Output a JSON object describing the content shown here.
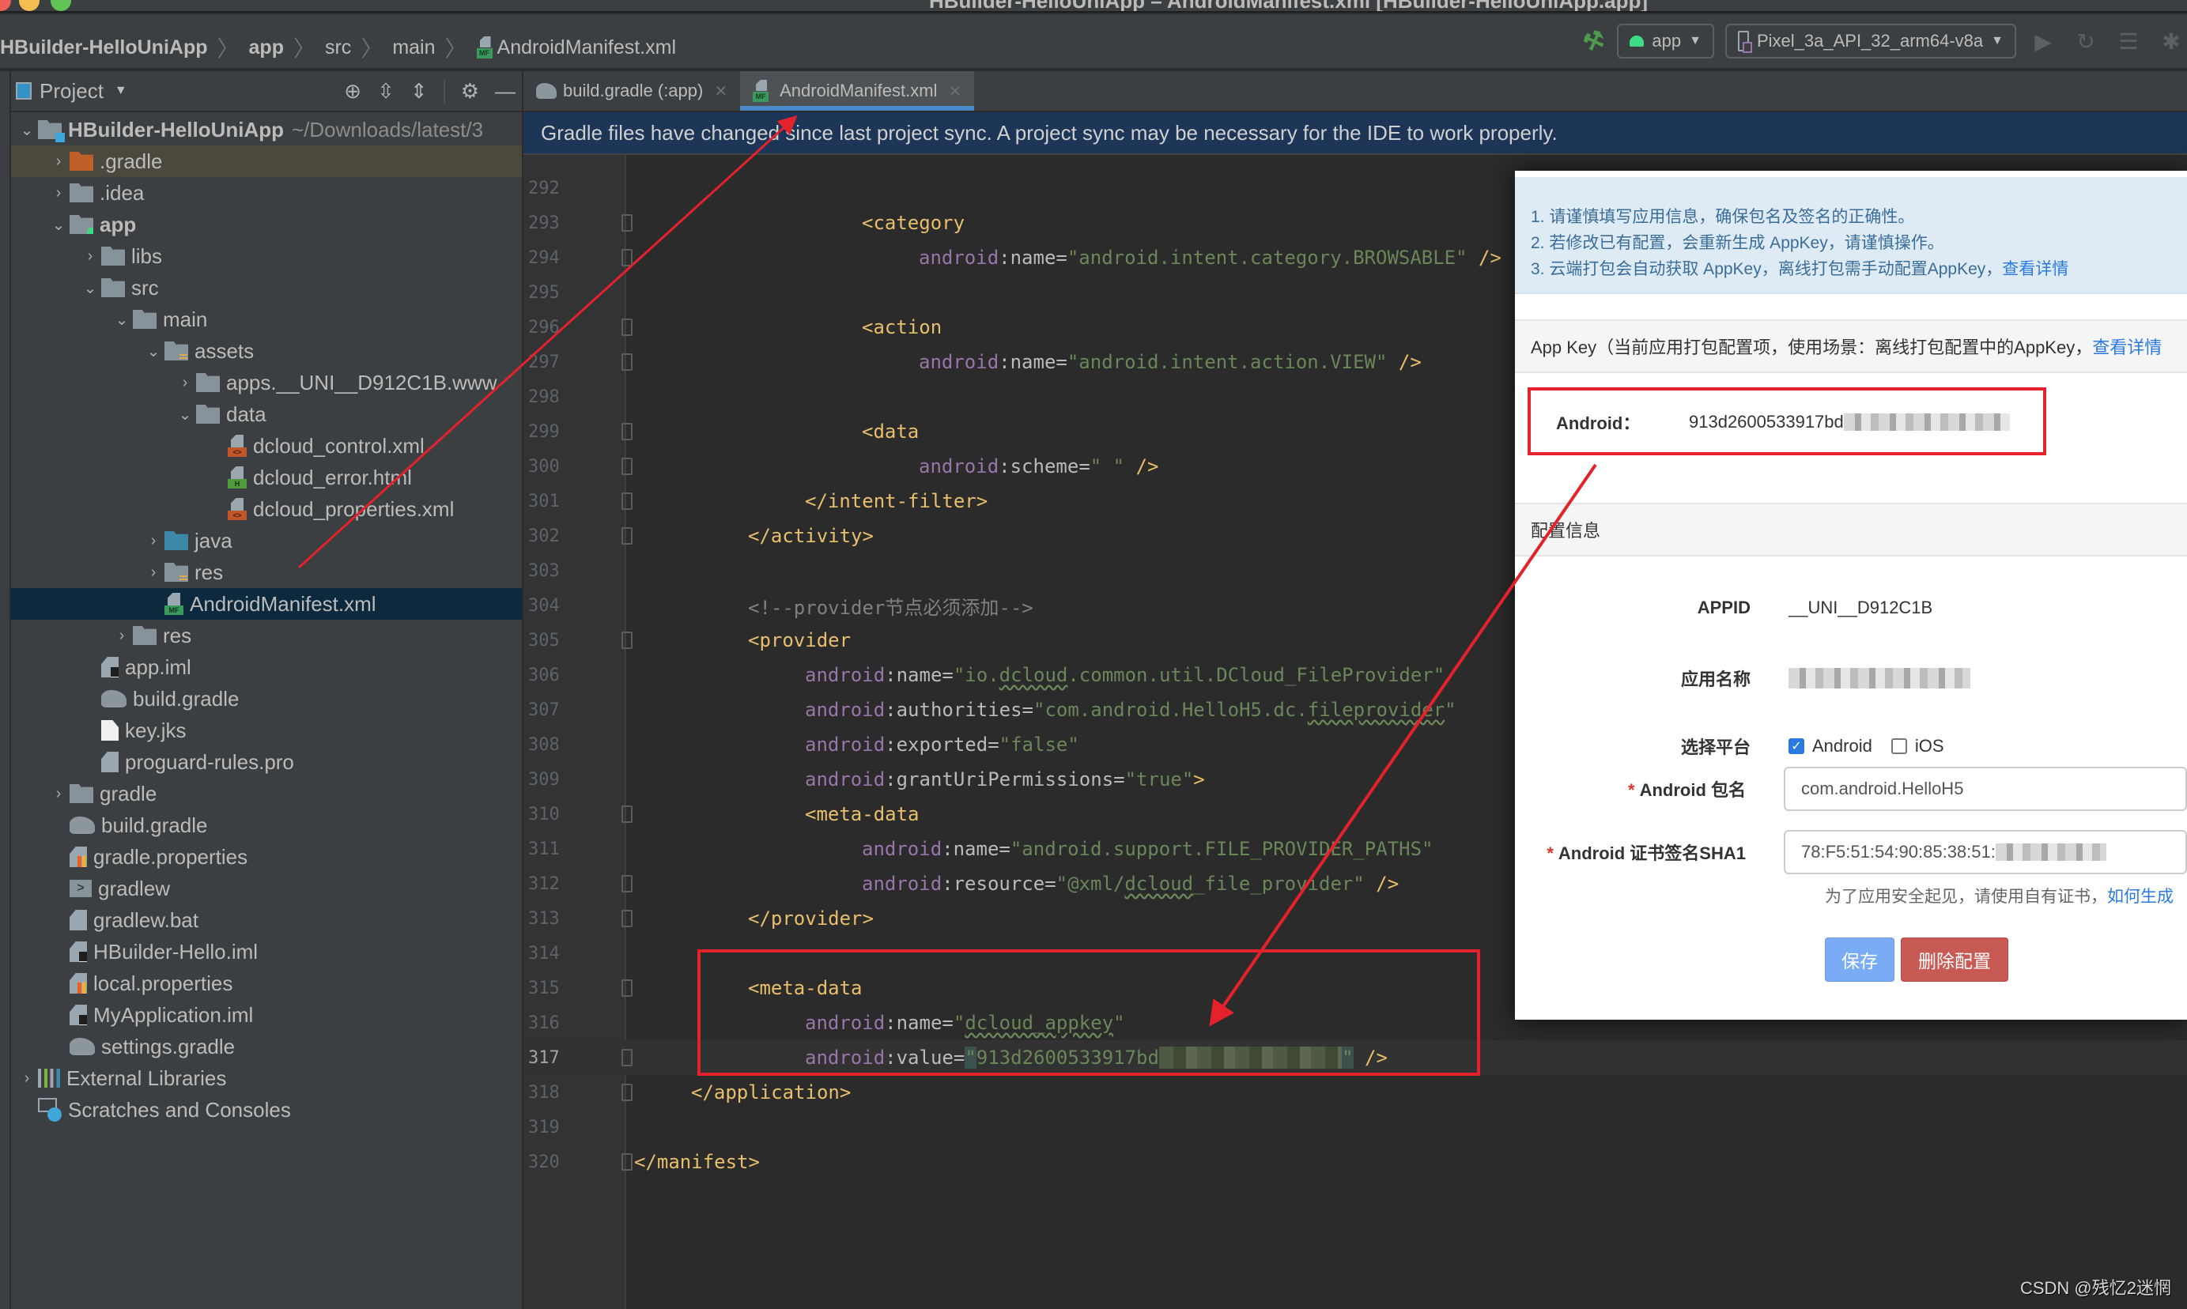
{
  "window": {
    "title": "HBuilder-HelloUniApp – AndroidManifest.xml [HBuilder-HelloUniApp.app]"
  },
  "navbar": {
    "breadcrumbs": [
      "HBuilder-HelloUniApp",
      "app",
      "src",
      "main",
      "AndroidManifest.xml"
    ],
    "run_config": "app",
    "device": "Pixel_3a_API_32_arm64-v8a",
    "icons": [
      "hammer-icon",
      "run-icon",
      "apply-changes-icon",
      "apply-code-changes-icon",
      "debug-icon"
    ]
  },
  "project_panel": {
    "title": "Project",
    "tools": [
      "locate-icon",
      "expand-all-icon",
      "collapse-all-icon",
      "gear-icon",
      "minimize-icon"
    ],
    "tree": [
      {
        "label": "HBuilder-HelloUniApp",
        "path": "~/Downloads/latest/3",
        "depth": 0,
        "expanded": true,
        "icon": "project-folder",
        "bold": true
      },
      {
        "label": ".gradle",
        "depth": 1,
        "expanded": false,
        "icon": "folder-orange"
      },
      {
        "label": ".idea",
        "depth": 1,
        "expanded": false,
        "icon": "folder"
      },
      {
        "label": "app",
        "depth": 1,
        "expanded": true,
        "icon": "module-folder",
        "bold": true
      },
      {
        "label": "libs",
        "depth": 2,
        "expanded": false,
        "icon": "folder"
      },
      {
        "label": "src",
        "depth": 2,
        "expanded": true,
        "icon": "folder"
      },
      {
        "label": "main",
        "depth": 3,
        "expanded": true,
        "icon": "folder"
      },
      {
        "label": "assets",
        "depth": 4,
        "expanded": true,
        "icon": "resource-folder"
      },
      {
        "label": "apps.__UNI__D912C1B.www",
        "depth": 5,
        "expanded": false,
        "icon": "folder"
      },
      {
        "label": "data",
        "depth": 5,
        "expanded": true,
        "icon": "folder"
      },
      {
        "label": "dcloud_control.xml",
        "depth": 6,
        "icon": "xml-file"
      },
      {
        "label": "dcloud_error.html",
        "depth": 6,
        "icon": "html-file"
      },
      {
        "label": "dcloud_properties.xml",
        "depth": 6,
        "icon": "xml-file"
      },
      {
        "label": "java",
        "depth": 4,
        "expanded": false,
        "icon": "source-folder"
      },
      {
        "label": "res",
        "depth": 4,
        "expanded": false,
        "icon": "resource-folder"
      },
      {
        "label": "AndroidManifest.xml",
        "depth": 4,
        "icon": "manifest-file",
        "selected": true
      },
      {
        "label": "res",
        "depth": 3,
        "expanded": false,
        "icon": "folder"
      },
      {
        "label": "app.iml",
        "depth": 2,
        "icon": "iml-file"
      },
      {
        "label": "build.gradle",
        "depth": 2,
        "icon": "gradle-file"
      },
      {
        "label": "key.jks",
        "depth": 2,
        "icon": "plain-file"
      },
      {
        "label": "proguard-rules.pro",
        "depth": 2,
        "icon": "text-file"
      },
      {
        "label": "gradle",
        "depth": 1,
        "expanded": false,
        "icon": "folder"
      },
      {
        "label": "build.gradle",
        "depth": 1,
        "icon": "gradle-file"
      },
      {
        "label": "gradle.properties",
        "depth": 1,
        "icon": "properties-file"
      },
      {
        "label": "gradlew",
        "depth": 1,
        "icon": "shell-file"
      },
      {
        "label": "gradlew.bat",
        "depth": 1,
        "icon": "text-file"
      },
      {
        "label": "HBuilder-Hello.iml",
        "depth": 1,
        "icon": "iml-file"
      },
      {
        "label": "local.properties",
        "depth": 1,
        "icon": "properties-file"
      },
      {
        "label": "MyApplication.iml",
        "depth": 1,
        "icon": "iml-file"
      },
      {
        "label": "settings.gradle",
        "depth": 1,
        "icon": "gradle-file"
      },
      {
        "label": "External Libraries",
        "depth": 0,
        "expanded": false,
        "icon": "libraries"
      },
      {
        "label": "Scratches and Consoles",
        "depth": 0,
        "icon": "scratches"
      }
    ]
  },
  "editor": {
    "tabs": [
      {
        "label": "build.gradle (:app)",
        "active": false
      },
      {
        "label": "AndroidManifest.xml",
        "active": true
      }
    ],
    "banner": "Gradle files have changed since last project sync. A project sync may be necessary for the IDE to work properly.",
    "current_line": 317,
    "lines": [
      {
        "n": 292,
        "indent": 0,
        "tokens": []
      },
      {
        "n": 293,
        "indent": 16,
        "fold": "open",
        "tokens": [
          [
            "tag",
            "<category"
          ]
        ]
      },
      {
        "n": 294,
        "indent": 20,
        "fold": "close",
        "tokens": [
          [
            "ns",
            "android"
          ],
          [
            "attr",
            ":name"
          ],
          [
            "plain",
            "="
          ],
          [
            "str",
            "\"android.intent.category.BROWSABLE\""
          ],
          [
            "tag",
            " />"
          ]
        ]
      },
      {
        "n": 295,
        "indent": 0,
        "tokens": []
      },
      {
        "n": 296,
        "indent": 16,
        "fold": "open",
        "tokens": [
          [
            "tag",
            "<action"
          ]
        ]
      },
      {
        "n": 297,
        "indent": 20,
        "fold": "close",
        "tokens": [
          [
            "ns",
            "android"
          ],
          [
            "attr",
            ":name"
          ],
          [
            "plain",
            "="
          ],
          [
            "str",
            "\"android.intent.action.VIEW\""
          ],
          [
            "tag",
            " />"
          ]
        ]
      },
      {
        "n": 298,
        "indent": 0,
        "tokens": []
      },
      {
        "n": 299,
        "indent": 16,
        "fold": "open",
        "tokens": [
          [
            "tag",
            "<data"
          ]
        ]
      },
      {
        "n": 300,
        "indent": 20,
        "fold": "close",
        "tokens": [
          [
            "ns",
            "android"
          ],
          [
            "attr",
            ":scheme"
          ],
          [
            "plain",
            "="
          ],
          [
            "str",
            "\" \""
          ],
          [
            "tag",
            " />"
          ]
        ]
      },
      {
        "n": 301,
        "indent": 12,
        "fold": "close",
        "tokens": [
          [
            "tag",
            "</intent-filter>"
          ]
        ]
      },
      {
        "n": 302,
        "indent": 8,
        "fold": "close",
        "tokens": [
          [
            "tag",
            "</activity>"
          ]
        ]
      },
      {
        "n": 303,
        "indent": 0,
        "tokens": []
      },
      {
        "n": 304,
        "indent": 8,
        "tokens": [
          [
            "cmt",
            "<!--provider节点必须添加-->"
          ]
        ]
      },
      {
        "n": 305,
        "indent": 8,
        "fold": "open",
        "tokens": [
          [
            "tag",
            "<provider"
          ]
        ]
      },
      {
        "n": 306,
        "indent": 12,
        "tokens": [
          [
            "ns",
            "android"
          ],
          [
            "attr",
            ":name"
          ],
          [
            "plain",
            "="
          ],
          [
            "str",
            "\"io."
          ],
          [
            "strw",
            "dcloud"
          ],
          [
            "str",
            ".common.util.DCloud_FileProvider\""
          ]
        ]
      },
      {
        "n": 307,
        "indent": 12,
        "tokens": [
          [
            "ns",
            "android"
          ],
          [
            "attr",
            ":authorities"
          ],
          [
            "plain",
            "="
          ],
          [
            "str",
            "\"com.android.HelloH5.dc."
          ],
          [
            "strw",
            "fileprovider"
          ],
          [
            "str",
            "\""
          ]
        ]
      },
      {
        "n": 308,
        "indent": 12,
        "tokens": [
          [
            "ns",
            "android"
          ],
          [
            "attr",
            ":exported"
          ],
          [
            "plain",
            "="
          ],
          [
            "str",
            "\"false\""
          ]
        ]
      },
      {
        "n": 309,
        "indent": 12,
        "tokens": [
          [
            "ns",
            "android"
          ],
          [
            "attr",
            ":grantUriPermissions"
          ],
          [
            "plain",
            "="
          ],
          [
            "str",
            "\"true\""
          ],
          [
            "tag",
            ">"
          ]
        ]
      },
      {
        "n": 310,
        "indent": 12,
        "fold": "open",
        "tokens": [
          [
            "tag",
            "<meta-data"
          ]
        ]
      },
      {
        "n": 311,
        "indent": 16,
        "tokens": [
          [
            "ns",
            "android"
          ],
          [
            "attr",
            ":name"
          ],
          [
            "plain",
            "="
          ],
          [
            "str",
            "\"android.support.FILE_PROVIDER_PATHS\""
          ]
        ]
      },
      {
        "n": 312,
        "indent": 16,
        "fold": "close",
        "tokens": [
          [
            "ns",
            "android"
          ],
          [
            "attr",
            ":resource"
          ],
          [
            "plain",
            "="
          ],
          [
            "str",
            "\"@xml/"
          ],
          [
            "strw",
            "dcloud"
          ],
          [
            "str",
            "_file_provider\""
          ],
          [
            "tag",
            " />"
          ]
        ]
      },
      {
        "n": 313,
        "indent": 8,
        "fold": "close",
        "tokens": [
          [
            "tag",
            "</provider>"
          ]
        ]
      },
      {
        "n": 314,
        "indent": 0,
        "tokens": []
      },
      {
        "n": 315,
        "indent": 8,
        "fold": "open",
        "tokens": [
          [
            "tag",
            "<meta-data"
          ]
        ]
      },
      {
        "n": 316,
        "indent": 12,
        "tokens": [
          [
            "ns",
            "android"
          ],
          [
            "attr",
            ":name"
          ],
          [
            "plain",
            "="
          ],
          [
            "str",
            "\""
          ],
          [
            "strw",
            "dcloud_appkey"
          ],
          [
            "str",
            "\""
          ]
        ]
      },
      {
        "n": 317,
        "indent": 12,
        "fold": "close",
        "tokens": [
          [
            "ns",
            "android"
          ],
          [
            "attr",
            ":value"
          ],
          [
            "plain",
            "="
          ],
          [
            "qhl",
            "\""
          ],
          [
            "str",
            "913d2600533917bd"
          ],
          [
            "blur",
            "xxxxxxxxxxxxxxxx"
          ],
          [
            "qhl",
            "\""
          ],
          [
            "tag",
            " />"
          ]
        ]
      },
      {
        "n": 318,
        "indent": 4,
        "fold": "close",
        "tokens": [
          [
            "tag",
            "</application>"
          ]
        ]
      },
      {
        "n": 319,
        "indent": 0,
        "tokens": []
      },
      {
        "n": 320,
        "indent": 0,
        "fold": "close",
        "tokens": [
          [
            "tag",
            "</manifest>"
          ]
        ]
      }
    ]
  },
  "web_panel": {
    "notice": {
      "line1": "1. 请谨慎填写应用信息，确保包名及签名的正确性。",
      "line2": "2. 若修改已有配置，会重新生成 AppKey，请谨慎操作。",
      "line3": "3. 云端打包会自动获取 AppKey，离线打包需手动配置AppKey，",
      "line3_link": "查看详情"
    },
    "appkey_section": {
      "title": "App Key（当前应用打包配置项，使用场景：离线打包配置中的AppKey，",
      "title_link": "查看详情",
      "platform_label": "Android：",
      "appkey_visible": "913d2600533917bd"
    },
    "config_section": {
      "title": "配置信息",
      "appid_label": "APPID",
      "appid_value": "__UNI__D912C1B",
      "app_name_label": "应用名称",
      "platform_label": "选择平台",
      "platforms": [
        {
          "label": "Android",
          "checked": true
        },
        {
          "label": "iOS",
          "checked": false
        }
      ],
      "package_label": "Android 包名",
      "package_value": "com.android.HelloH5",
      "sha1_label": "Android 证书签名SHA1",
      "sha1_value": "78:F5:51:54:90:85:38:51:",
      "hint": "为了应用安全起见，请使用自有证书，",
      "hint_link": "如何生成",
      "required_mark": "*",
      "save_button": "保存",
      "delete_button": "删除配置"
    }
  },
  "watermark": "CSDN @残忆2迷惘",
  "annotation_colors": {
    "red": "#e3222b"
  }
}
